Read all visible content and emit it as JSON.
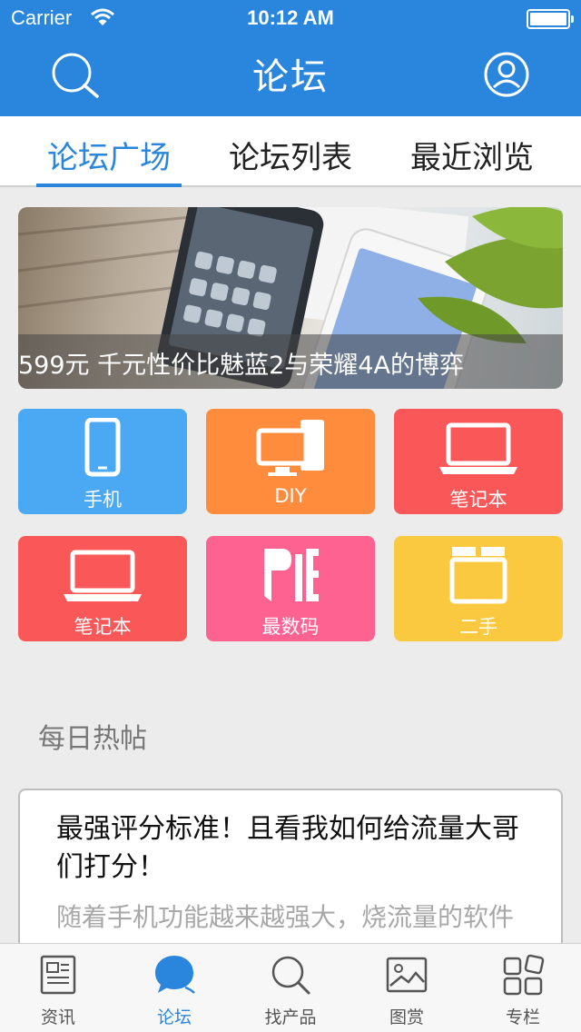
{
  "status_bar": {
    "carrier": "Carrier",
    "time": "10:12 AM"
  },
  "nav": {
    "title": "论坛",
    "left_icon": "search-icon",
    "right_icon": "user-icon"
  },
  "tabs": [
    {
      "label": "论坛广场",
      "active": true
    },
    {
      "label": "论坛列表",
      "active": false
    },
    {
      "label": "最近浏览",
      "active": false
    }
  ],
  "banner": {
    "caption": "599元 千元性价比魅蓝2与荣耀4A的博弈"
  },
  "categories": [
    {
      "label": "手机",
      "icon": "phone-icon",
      "color": "#4aa9f2"
    },
    {
      "label": "DIY",
      "icon": "desktop-icon",
      "color": "#ff8c3c"
    },
    {
      "label": "笔记本",
      "icon": "laptop-icon",
      "color": "#fa5858"
    },
    {
      "label": "笔记本",
      "icon": "laptop-icon",
      "color": "#fa5858"
    },
    {
      "label": "最数码",
      "icon": "pie-logo-icon",
      "color": "#fd6290"
    },
    {
      "label": "二手",
      "icon": "box-icon",
      "color": "#fbc93f"
    }
  ],
  "daily": {
    "title": "每日热帖",
    "post": {
      "title": "最强评分标准！且看我如何给流量大哥们打分！",
      "excerpt": "随着手机功能越来越强大，烧流量的软件"
    }
  },
  "tabbar": [
    {
      "label": "资讯",
      "icon": "news-icon",
      "active": false
    },
    {
      "label": "论坛",
      "icon": "chat-bubble-icon",
      "active": true
    },
    {
      "label": "找产品",
      "icon": "search-icon",
      "active": false
    },
    {
      "label": "图赏",
      "icon": "image-icon",
      "active": false
    },
    {
      "label": "专栏",
      "icon": "grid-icon",
      "active": false
    }
  ],
  "colors": {
    "primary": "#2a86dc",
    "background": "#ececec"
  }
}
